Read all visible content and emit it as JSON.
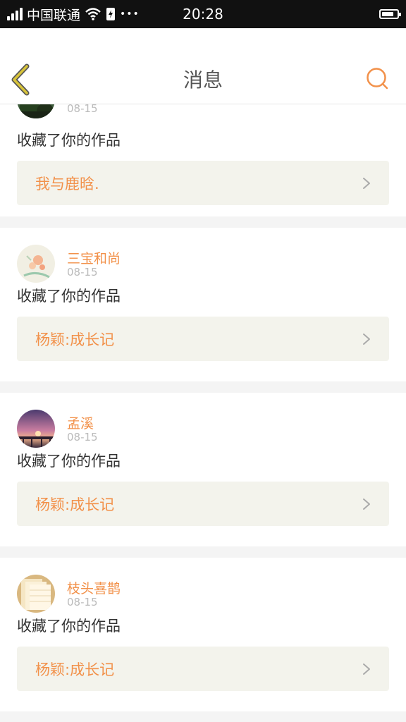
{
  "status_bar": {
    "carrier": "中国联通",
    "time": "20:28",
    "battery_level": 0.8,
    "more": "•••"
  },
  "header": {
    "title": "消息"
  },
  "colors": {
    "accent": "#f2914a",
    "back_icon": "#c8b52c",
    "card_link_bg": "#f3f3ec"
  },
  "messages": [
    {
      "user": "",
      "date": "08-15",
      "action": "收藏了你的作品",
      "work": "我与鹿晗."
    },
    {
      "user": "三宝和尚",
      "date": "08-15",
      "action": "收藏了你的作品",
      "work": "杨颖:成长记"
    },
    {
      "user": "孟溪",
      "date": "08-15",
      "action": "收藏了你的作品",
      "work": "杨颖:成长记"
    },
    {
      "user": "枝头喜鹊",
      "date": "08-15",
      "action": "收藏了你的作品",
      "work": "杨颖:成长记"
    }
  ]
}
